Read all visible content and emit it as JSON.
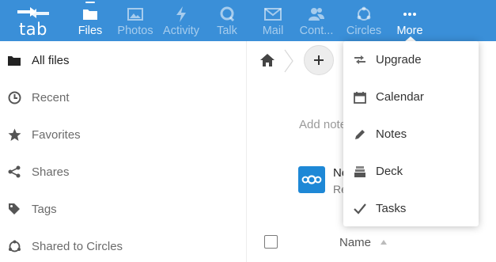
{
  "brand": {
    "logo_text": "tab",
    "accent": "#3a8fd8"
  },
  "header": {
    "apps": [
      {
        "label": "Files",
        "icon": "folder-icon",
        "active": true
      },
      {
        "label": "Photos",
        "icon": "image-icon",
        "active": false
      },
      {
        "label": "Activity",
        "icon": "lightning-icon",
        "active": false
      },
      {
        "label": "Talk",
        "icon": "talk-icon",
        "active": false
      },
      {
        "label": "Mail",
        "icon": "mail-icon",
        "active": false
      },
      {
        "label": "Cont...",
        "icon": "contacts-icon",
        "active": false
      },
      {
        "label": "Circles",
        "icon": "circles-icon",
        "active": false
      },
      {
        "label": "More",
        "icon": "more-icon",
        "active": true
      }
    ]
  },
  "sidebar": {
    "items": [
      {
        "label": "All files",
        "icon": "folder-icon",
        "active": true
      },
      {
        "label": "Recent",
        "icon": "clock-icon",
        "active": false
      },
      {
        "label": "Favorites",
        "icon": "star-icon",
        "active": false
      },
      {
        "label": "Shares",
        "icon": "share-icon",
        "active": false
      },
      {
        "label": "Tags",
        "icon": "tag-icon",
        "active": false
      },
      {
        "label": "Shared to Circles",
        "icon": "circles-icon",
        "active": false
      }
    ]
  },
  "main": {
    "notes_placeholder": "Add note",
    "file": {
      "name": "Ne",
      "subtitle": "Re"
    },
    "table": {
      "column_name": "Name"
    }
  },
  "more_menu": {
    "items": [
      {
        "label": "Upgrade",
        "icon": "upgrade-icon"
      },
      {
        "label": "Calendar",
        "icon": "calendar-icon"
      },
      {
        "label": "Notes",
        "icon": "pencil-icon"
      },
      {
        "label": "Deck",
        "icon": "deck-icon"
      },
      {
        "label": "Tasks",
        "icon": "checkmark-icon"
      }
    ]
  }
}
